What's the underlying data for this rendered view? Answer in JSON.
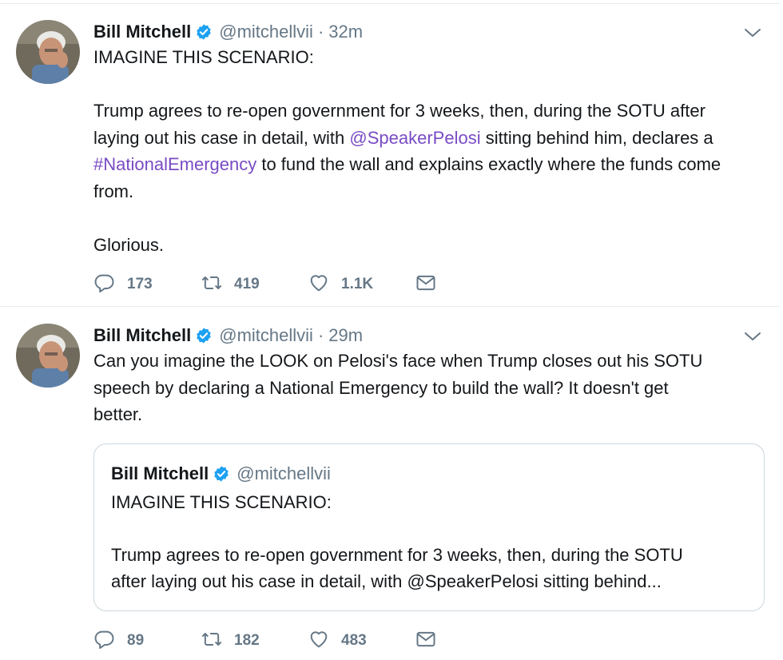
{
  "tweets": [
    {
      "name": "Bill Mitchell",
      "handle": "@mitchellvii",
      "separator": "·",
      "time": "32m",
      "lines": {
        "l1": "IMAGINE THIS SCENARIO:",
        "l2": "Trump agrees to re-open government for 3 weeks, then, during the SOTU after",
        "l3a": "laying out his case in detail, with ",
        "l3link": "@SpeakerPelosi",
        "l3b": " sitting behind him, declares a",
        "l4link": "#NationalEmergency",
        "l4b": " to fund the wall and explains exactly where the funds come",
        "l5": "from.",
        "l6": "Glorious."
      },
      "replies": "173",
      "retweets": "419",
      "likes": "1.1K"
    },
    {
      "name": "Bill Mitchell",
      "handle": "@mitchellvii",
      "separator": "·",
      "time": "29m",
      "lines": {
        "l1": "Can you imagine the LOOK on Pelosi's face when Trump closes out his SOTU",
        "l2": "speech by declaring a National Emergency to build the wall?  It doesn't get",
        "l3": "better."
      },
      "quote": {
        "name": "Bill Mitchell",
        "handle": "@mitchellvii",
        "l1": "IMAGINE THIS SCENARIO:",
        "l2": "Trump agrees to re-open government for 3 weeks, then, during the SOTU",
        "l3": "after laying out his case in detail, with @SpeakerPelosi sitting behind..."
      },
      "replies": "89",
      "retweets": "182",
      "likes": "483"
    }
  ],
  "colors": {
    "link": "#794bc4",
    "verified": "#1da1f2",
    "muted": "#657786",
    "text": "#14171a",
    "border": "#e6ecf0"
  },
  "icons": [
    "verified-badge-icon",
    "chevron-down-icon",
    "reply-icon",
    "retweet-icon",
    "like-icon",
    "direct-message-icon"
  ]
}
